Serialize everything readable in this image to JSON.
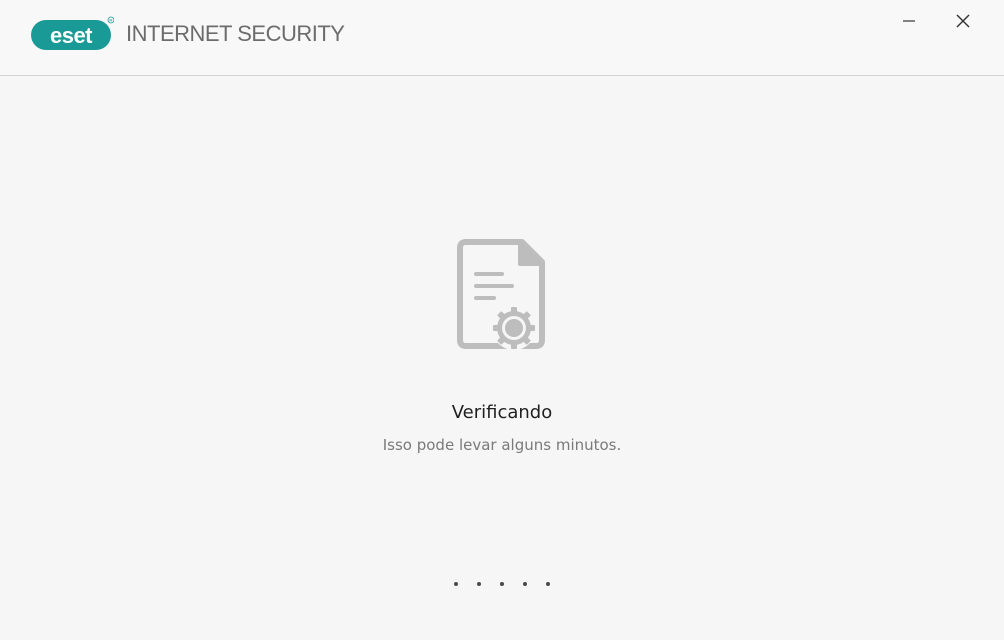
{
  "header": {
    "brand_logo": "eset",
    "product_name": "INTERNET SECURITY",
    "brand_color": "#1a9a97",
    "controls": {
      "minimize_icon": "minimize-icon",
      "close_icon": "close-icon"
    }
  },
  "main": {
    "icon": "certificate-document-icon",
    "title": "Verificando",
    "subtitle": "Isso pode levar alguns minutos.",
    "progress_dot_count": 5
  }
}
